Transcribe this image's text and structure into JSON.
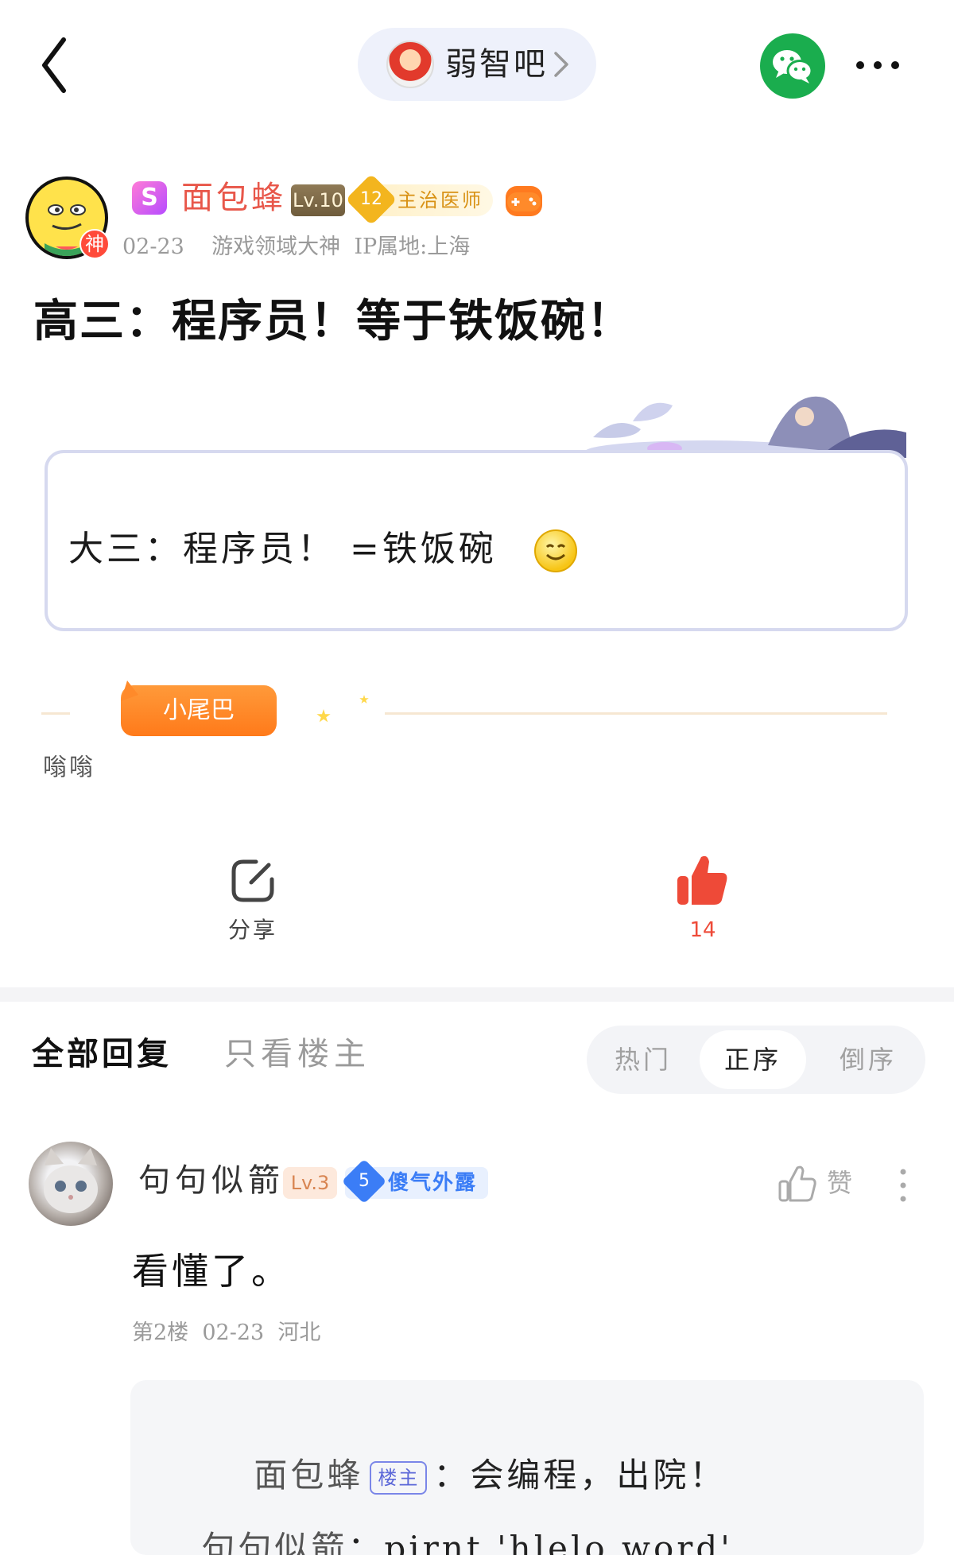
{
  "header": {
    "forum_name": "弱智吧",
    "icons": {
      "back": "back-arrow-icon",
      "forum_chevron": "chevron-right-icon",
      "wechat": "wechat-icon",
      "more": "more-horizontal-icon"
    },
    "colors": {
      "wechat": "#1aad4e",
      "pill_bg": "#eef1fb"
    }
  },
  "post": {
    "author": {
      "name": "面包蜂",
      "god_badge": "神",
      "level": "Lv.10",
      "honor_number": "12",
      "honor_label": "主治医师",
      "name_color": "#e8574a"
    },
    "meta": "02-23    游戏领域大神  IP属地:上海",
    "title": "高三：程序员！等于铁饭碗！",
    "quote": "大三：程序员！ =铁饭碗",
    "tail": {
      "badge": "小尾巴",
      "text": "嗡嗡"
    },
    "share_label": "分享",
    "like_count": "14",
    "like_color": "#ee4a38"
  },
  "replies": {
    "tabs": {
      "all": "全部回复",
      "op_only": "只看楼主"
    },
    "sort": {
      "hot": "热门",
      "asc": "正序",
      "desc": "倒序",
      "selected": "正序"
    },
    "items": [
      {
        "name": "句句似箭",
        "level": "Lv.3",
        "tag_number": "5",
        "tag_label": "傻气外露",
        "like_label": "赞",
        "text": "看懂了。",
        "meta": "第2楼  02-23  河北",
        "subreplies": [
          {
            "name": "面包蜂",
            "op_badge": "楼主",
            "text": "：会编程，出院！"
          },
          {
            "name": "句句似箭",
            "text": "：pirnt 'hlelo word'"
          }
        ]
      }
    ]
  }
}
